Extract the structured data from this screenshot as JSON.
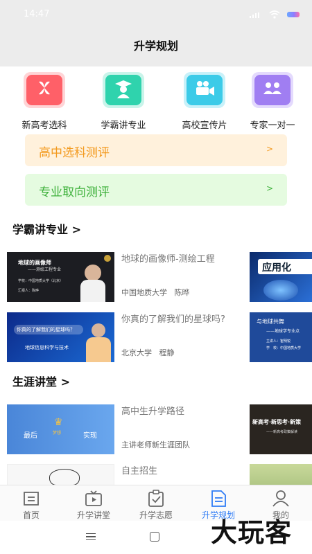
{
  "status_bar": {
    "time": "14:47"
  },
  "header": {
    "title": "升学规划"
  },
  "quick_actions": [
    {
      "label": "新高考选科",
      "icon": "flower-icon",
      "color": "#ff5a63"
    },
    {
      "label": "学霸讲专业",
      "icon": "graduate-icon",
      "color": "#25d0a8"
    },
    {
      "label": "高校宣传片",
      "icon": "video-camera-icon",
      "color": "#35c8e6"
    },
    {
      "label": "专家一对一",
      "icon": "consult-icon",
      "color": "#9b7bf0"
    }
  ],
  "evaluations": [
    {
      "label": "高中选科测评",
      "chevron": ">",
      "color": "#f39a1f",
      "bg": "#fff1dc"
    },
    {
      "label": "专业取向测评",
      "chevron": ">",
      "color": "#3db03a",
      "bg": "#e5fbe0"
    }
  ],
  "sections": [
    {
      "title": "学霸讲专业 >",
      "items": [
        {
          "title": "地球的画像师-测绘工程",
          "school": "中国地质大学",
          "speaker": "陈晔",
          "thumb_lines": [
            "地球的画像师",
            "——测绘工程专业",
            "学校：中国地质大学（北京）",
            "汇报人：陈晔"
          ]
        },
        {
          "title": "你真的了解我们的星球吗?",
          "school": "北京大学",
          "speaker": "程静",
          "thumb_lines": [
            "你真的了解我们的星球吗？",
            "地球信息科学与技术"
          ]
        }
      ],
      "side_thumbs": [
        {
          "lines": [
            "应用化"
          ]
        },
        {
          "lines": [
            "与地球共舞",
            "——地球学专业点",
            "主讲人：崔明锐",
            "学　校：中国地质大学"
          ]
        }
      ]
    },
    {
      "title": "生涯讲堂 >",
      "items": [
        {
          "title": "高中生升学路径",
          "meta": "主讲老师新生涯团队",
          "thumb_lines": [
            "最后",
            "实现",
            "梦想"
          ]
        },
        {
          "title": "自主招生",
          "meta": ""
        }
      ],
      "side_thumbs": [
        {
          "lines": [
            "新高考·新思考·新策",
            "——新高考政策解读"
          ]
        },
        {
          "lines": []
        }
      ]
    }
  ],
  "tab_bar": [
    {
      "label": "首页",
      "icon": "home-icon",
      "active": false
    },
    {
      "label": "升学讲堂",
      "icon": "tv-icon",
      "active": false
    },
    {
      "label": "升学志愿",
      "icon": "checklist-icon",
      "active": false
    },
    {
      "label": "升学规划",
      "icon": "document-icon",
      "active": true
    },
    {
      "label": "我的",
      "icon": "user-icon",
      "active": false
    }
  ],
  "watermark": "大玩客",
  "colors": {
    "accent": "#2f7cf6",
    "header_bg": "#ececec"
  }
}
